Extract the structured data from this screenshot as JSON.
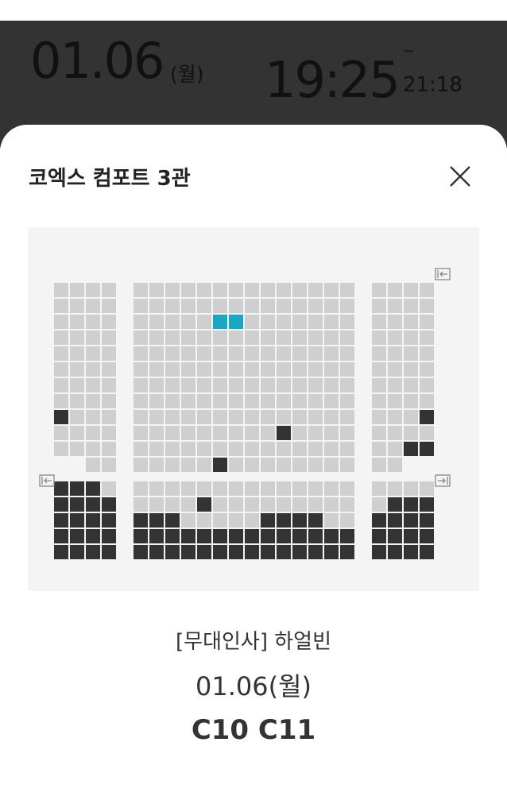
{
  "header": {
    "date": "01.06",
    "day": "(월)",
    "start_time": "19:25",
    "tilde": "~",
    "end_time": "21:18"
  },
  "sheet": {
    "theater": "코엑스 컴포트 3관",
    "close_icon": "close-icon"
  },
  "seatmap": {
    "rows": 17,
    "blocks": [
      {
        "name": "left",
        "cols": 4
      },
      {
        "name": "center",
        "cols": 14
      },
      {
        "name": "right",
        "cols": 4
      }
    ],
    "selected": [
      [
        2,
        5
      ],
      [
        2,
        6
      ]
    ],
    "occupied_left": [
      [
        8,
        0
      ],
      [
        12,
        0
      ],
      [
        12,
        1
      ],
      [
        12,
        2
      ],
      [
        13,
        0
      ],
      [
        13,
        1
      ],
      [
        13,
        2
      ],
      [
        13,
        3
      ],
      [
        14,
        0
      ],
      [
        14,
        1
      ],
      [
        14,
        2
      ],
      [
        14,
        3
      ],
      [
        15,
        0
      ],
      [
        15,
        1
      ],
      [
        15,
        2
      ],
      [
        15,
        3
      ],
      [
        16,
        0
      ],
      [
        16,
        1
      ],
      [
        16,
        2
      ],
      [
        16,
        3
      ]
    ],
    "occupied_center": [
      [
        9,
        9
      ],
      [
        11,
        5
      ],
      [
        13,
        4
      ],
      [
        14,
        0
      ],
      [
        14,
        1
      ],
      [
        14,
        2
      ],
      [
        14,
        8
      ],
      [
        14,
        9
      ],
      [
        14,
        10
      ],
      [
        14,
        11
      ],
      [
        15,
        0
      ],
      [
        15,
        1
      ],
      [
        15,
        2
      ],
      [
        15,
        3
      ],
      [
        15,
        4
      ],
      [
        15,
        5
      ],
      [
        15,
        6
      ],
      [
        15,
        7
      ],
      [
        15,
        8
      ],
      [
        15,
        9
      ],
      [
        15,
        10
      ],
      [
        15,
        11
      ],
      [
        15,
        12
      ],
      [
        15,
        13
      ],
      [
        16,
        0
      ],
      [
        16,
        1
      ],
      [
        16,
        2
      ],
      [
        16,
        3
      ],
      [
        16,
        4
      ],
      [
        16,
        5
      ],
      [
        16,
        6
      ],
      [
        16,
        7
      ],
      [
        16,
        8
      ],
      [
        16,
        9
      ],
      [
        16,
        10
      ],
      [
        16,
        11
      ],
      [
        16,
        12
      ],
      [
        16,
        13
      ]
    ],
    "occupied_right": [
      [
        8,
        3
      ],
      [
        10,
        2
      ],
      [
        10,
        3
      ],
      [
        13,
        1
      ],
      [
        13,
        2
      ],
      [
        13,
        3
      ],
      [
        14,
        0
      ],
      [
        14,
        1
      ],
      [
        14,
        2
      ],
      [
        14,
        3
      ],
      [
        15,
        0
      ],
      [
        15,
        1
      ],
      [
        15,
        2
      ],
      [
        15,
        3
      ],
      [
        16,
        0
      ],
      [
        16,
        1
      ],
      [
        16,
        2
      ],
      [
        16,
        3
      ]
    ],
    "colors": {
      "available": "#cfcfcf",
      "occupied": "#333333",
      "selected": "#1aa7c4"
    },
    "exit_icons": [
      "exit-left-icon",
      "exit-right-icon"
    ]
  },
  "booking": {
    "title": "[무대인사] 하얼빈",
    "date": "01.06(월)",
    "seats": "C10 C11"
  }
}
